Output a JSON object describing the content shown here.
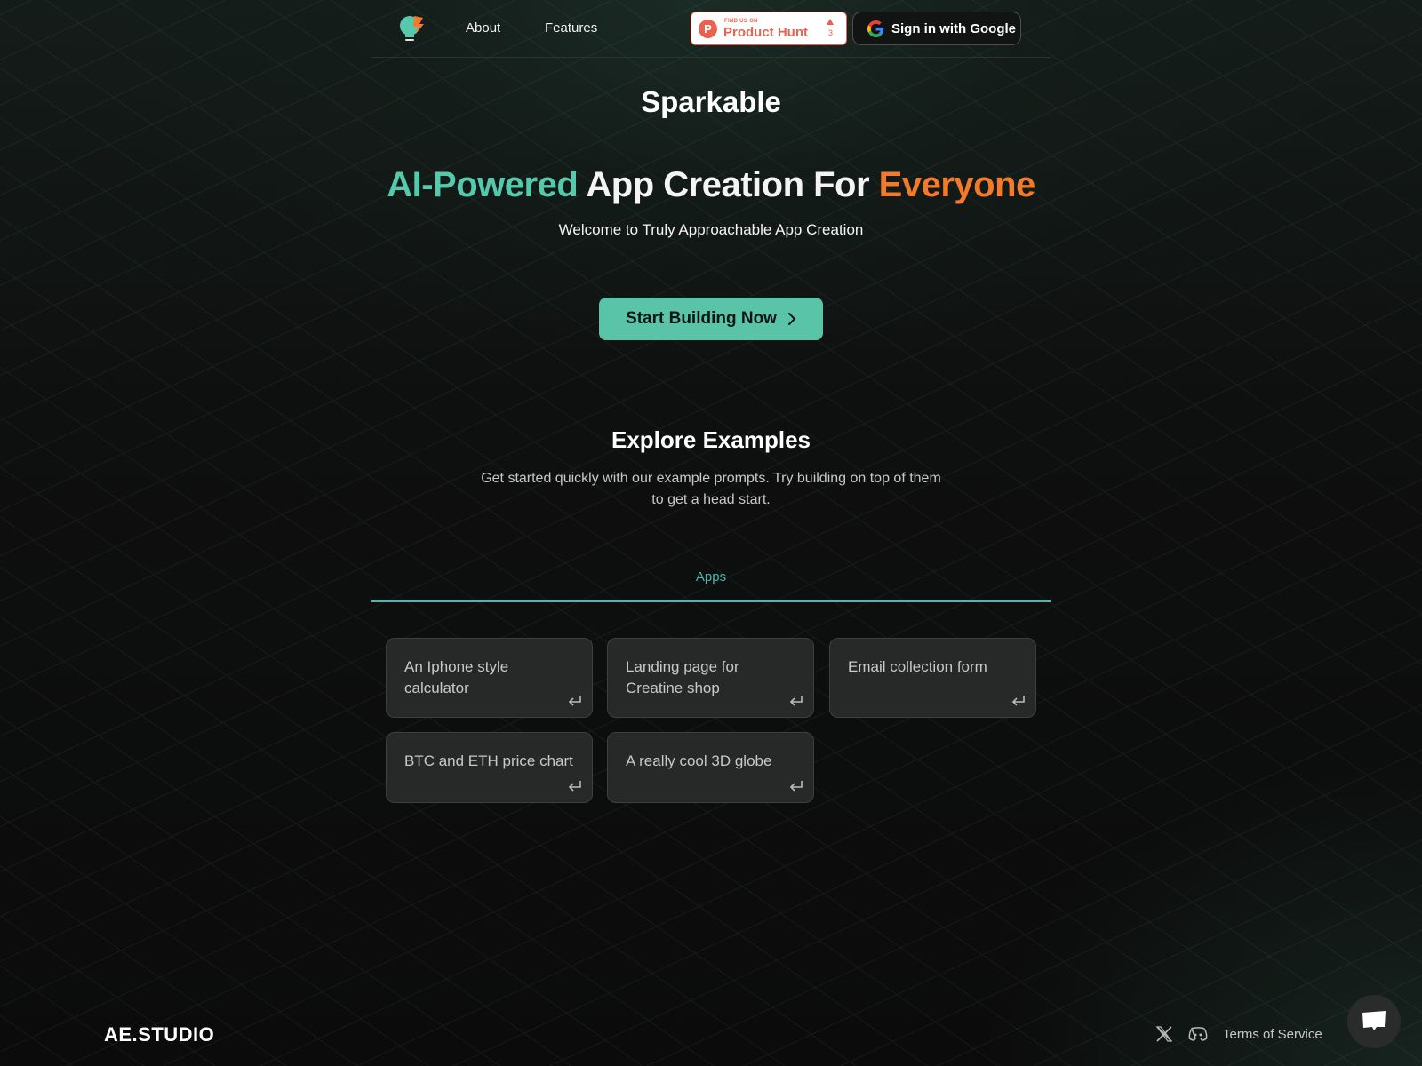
{
  "header": {
    "logo_icon": "lightbulb-spark-icon",
    "nav": [
      {
        "label": "About"
      },
      {
        "label": "Features"
      }
    ],
    "product_hunt": {
      "small_label": "FIND US ON",
      "big_label": "Product Hunt",
      "upvotes": "3",
      "icon": "product-hunt-icon"
    },
    "google_signin": {
      "label": "Sign in with Google",
      "icon": "google-icon"
    }
  },
  "hero": {
    "brand": "Sparkable",
    "title_accent": "AI-Powered",
    "title_main": " App Creation For ",
    "title_orange": "Everyone",
    "subtitle": "Welcome to Truly Approachable App Creation",
    "cta_label": "Start Building Now",
    "colors": {
      "accent": "#56c8ab",
      "orange": "#f27a2a",
      "cta_bg": "#5ac4a8"
    }
  },
  "examples": {
    "title": "Explore Examples",
    "subtitle": "Get started quickly with our example prompts. Try building on top of them to get a head start.",
    "tabs": [
      {
        "label": "Apps",
        "active": true
      }
    ],
    "cards": [
      {
        "label": "An Iphone style calculator"
      },
      {
        "label": "Landing page for Creatine shop"
      },
      {
        "label": "Email collection form"
      },
      {
        "label": "BTC and ETH price chart"
      },
      {
        "label": "A really cool 3D globe"
      }
    ]
  },
  "footer": {
    "brand": "AE.STUDIO",
    "links": [
      {
        "icon": "x-twitter-icon"
      },
      {
        "icon": "discord-icon"
      },
      {
        "label": "Terms of Service"
      }
    ],
    "chat_icon": "chat-icon"
  }
}
